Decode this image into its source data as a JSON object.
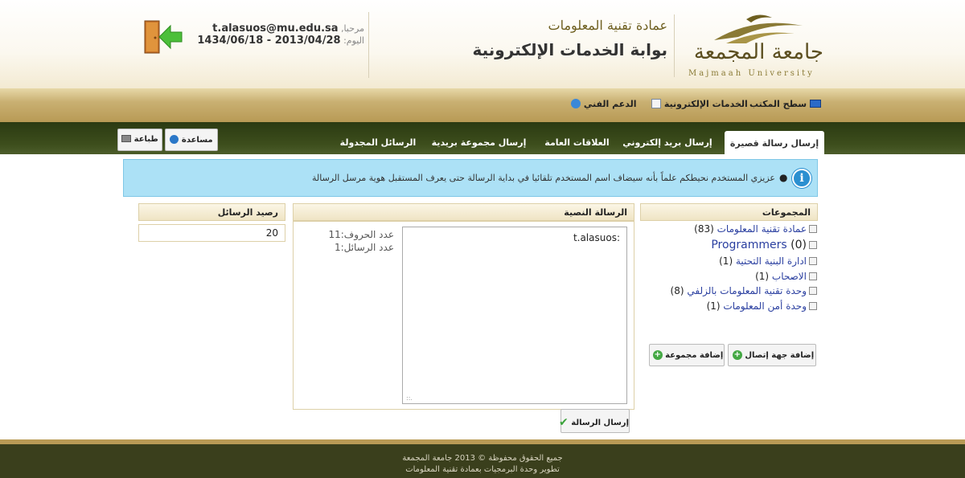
{
  "header": {
    "university_ar": "جامعة المجمعة",
    "university_en": "Majmaah University",
    "department": "عمادة تقنية المعلومات",
    "portal_title": "بوابة الخدمات الإلكترونية",
    "welcome_label": "مرحبا,",
    "user_email": "t.alasuos@mu.edu.sa",
    "date_label": "اليوم:",
    "date_value": "2013/04/28 - 1434/06/18"
  },
  "nav": {
    "desktop": "سطح المكتب",
    "eservices": "الخدمات الإلكترونية",
    "support": "الدعم الفني"
  },
  "tabs": {
    "sms": "إرسال رسالة قصيرة",
    "email": "إرسال بريد إلكتروني",
    "pr": "العلاقات العامة",
    "mailgroup": "إرسال مجموعة بريدية",
    "scheduled": "الرسائل المجدولة",
    "help": "مساعدة",
    "print": "طباعة"
  },
  "info_message": "عزيزي المستخدم نحيطكم علماً بأنه سيضاف اسم المستخدم تلقائيا في بداية الرسالة حتى يعرف المستقبل هوية مرسل الرسالة",
  "groups": {
    "title": "المجموعات",
    "items": [
      {
        "name": "عمادة تقنية المعلومات",
        "count": "(83)"
      },
      {
        "name": "Programmers",
        "count": "(0)"
      },
      {
        "name": "ادارة البنية التحتية",
        "count": "(1)"
      },
      {
        "name": "الاصحاب",
        "count": "(1)"
      },
      {
        "name": "وحدة تقنية المعلومات بالزلفي",
        "count": "(8)"
      },
      {
        "name": "وحدة أمن المعلومات",
        "count": "(1)"
      }
    ],
    "add_contact": "إضافة جهة إتصال",
    "add_group": "إضافة مجموعة"
  },
  "message": {
    "title": "الرسالة النصية",
    "text_value": "t.alasuos:",
    "chars_label": "عدد الحروف:",
    "chars_value": "11",
    "msgs_label": "عدد الرسائل:",
    "msgs_value": "1",
    "send": "إرسال الرسالة"
  },
  "balance": {
    "title": "رصيد الرسائل",
    "value": "20"
  },
  "footer": {
    "line1": "جميع الحقوق محفوظة © 2013 جامعة المجمعة",
    "line2": "تطوير وحدة البرمجيات بعمادة تقنية المعلومات"
  },
  "colors": {
    "gold": "#b89a55",
    "dark_green": "#3a3f1c",
    "info_blue": "#ace1f6",
    "link_blue": "#2a3fa0"
  }
}
